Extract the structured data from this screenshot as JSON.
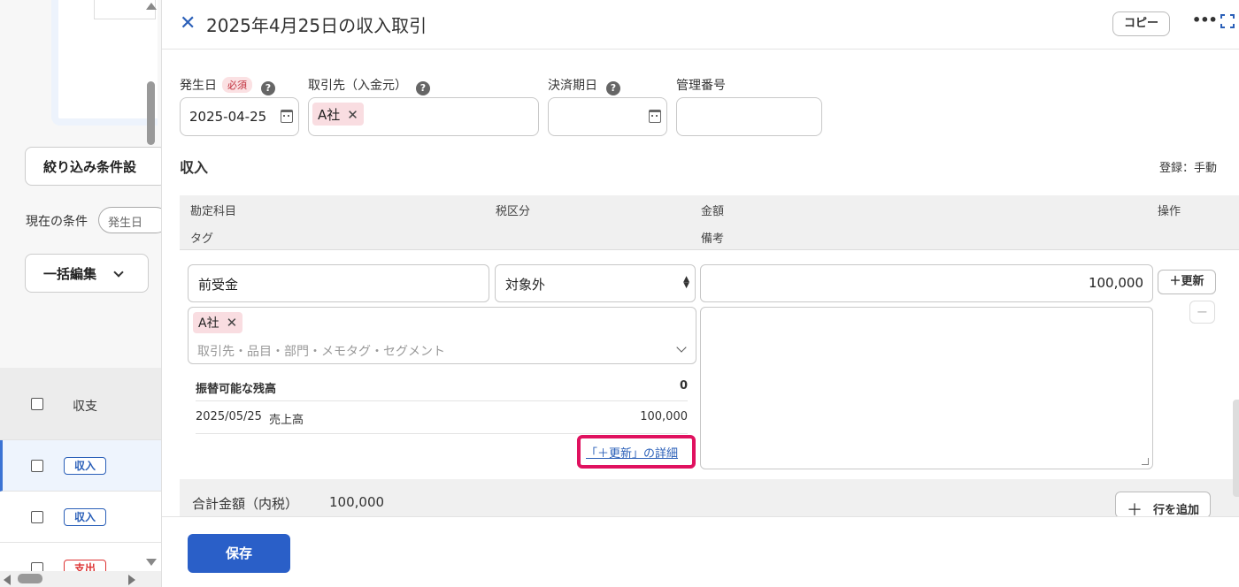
{
  "background": {
    "filter_button": "絞り込み条件設",
    "current_conditions_label": "現在の条件",
    "condition_pill": "発生日",
    "bulk_edit_button": "一括編集",
    "table_header": "収支",
    "rows": [
      {
        "tag": "収入",
        "type": "income"
      },
      {
        "tag": "収入",
        "type": "income"
      },
      {
        "tag": "支出",
        "type": "expense"
      }
    ]
  },
  "header": {
    "title": "2025年4月25日の収入取引",
    "copy_button": "コピー",
    "more_icon": "more-horizontal-icon",
    "expand_icon": "expand-icon"
  },
  "form": {
    "date_label": "発生日",
    "required_badge": "必須",
    "date_value": "2025-04-25",
    "partner_label": "取引先（入金元）",
    "partner_chip": "A社",
    "due_date_label": "決済期日",
    "due_date_value": "",
    "management_no_label": "管理番号",
    "management_no_value": ""
  },
  "income_section": {
    "title": "収入",
    "registration": "登録：手動",
    "columns": {
      "account": "勘定科目",
      "tax": "税区分",
      "amount": "金額",
      "action": "操作",
      "tag": "タグ",
      "memo": "備考"
    },
    "row": {
      "account": "前受金",
      "tax": "対象外",
      "amount": "100,000",
      "update_button": "＋更新",
      "tag_chip": "A社",
      "tag_placeholder": "取引先・品目・部門・メモタグ・セグメント",
      "memo": ""
    },
    "balance": {
      "label": "振替可能な残高",
      "value": "0",
      "entry_date": "2025/05/25",
      "entry_account": "売上高",
      "entry_amount": "100,000"
    },
    "detail_link": "「＋更新」の詳細"
  },
  "total": {
    "label": "合計金額（内税）",
    "value": "100,000",
    "add_row_button": "行を追加"
  },
  "footer": {
    "save_button": "保存"
  },
  "colors": {
    "accent": "#2a5fc8",
    "chip_bg": "#f9dde1",
    "highlight": "#e0115f"
  }
}
